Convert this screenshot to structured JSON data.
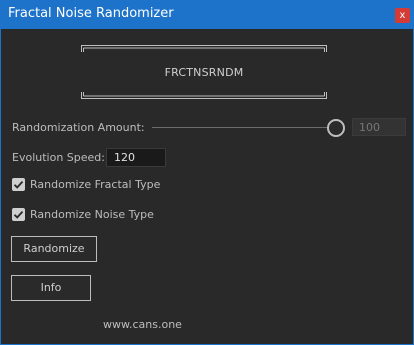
{
  "window": {
    "title": "Fractal Noise Randomizer",
    "close_label": "x"
  },
  "logo": {
    "text": "FRCTNSRNDM"
  },
  "randomization": {
    "label": "Randomization Amount:",
    "value": 100,
    "value_text": "100"
  },
  "evolution": {
    "label": "Evolution Speed:",
    "value": "120"
  },
  "options": {
    "fractal_label": "Randomize Fractal Type",
    "fractal_checked": true,
    "noise_label": "Randomize Noise Type",
    "noise_checked": true
  },
  "buttons": {
    "randomize": "Randomize",
    "info": "Info"
  },
  "footer": {
    "url": "www.cans.one"
  },
  "colors": {
    "titlebar": "#1d73c9",
    "close": "#d33b34",
    "background": "#292929"
  }
}
